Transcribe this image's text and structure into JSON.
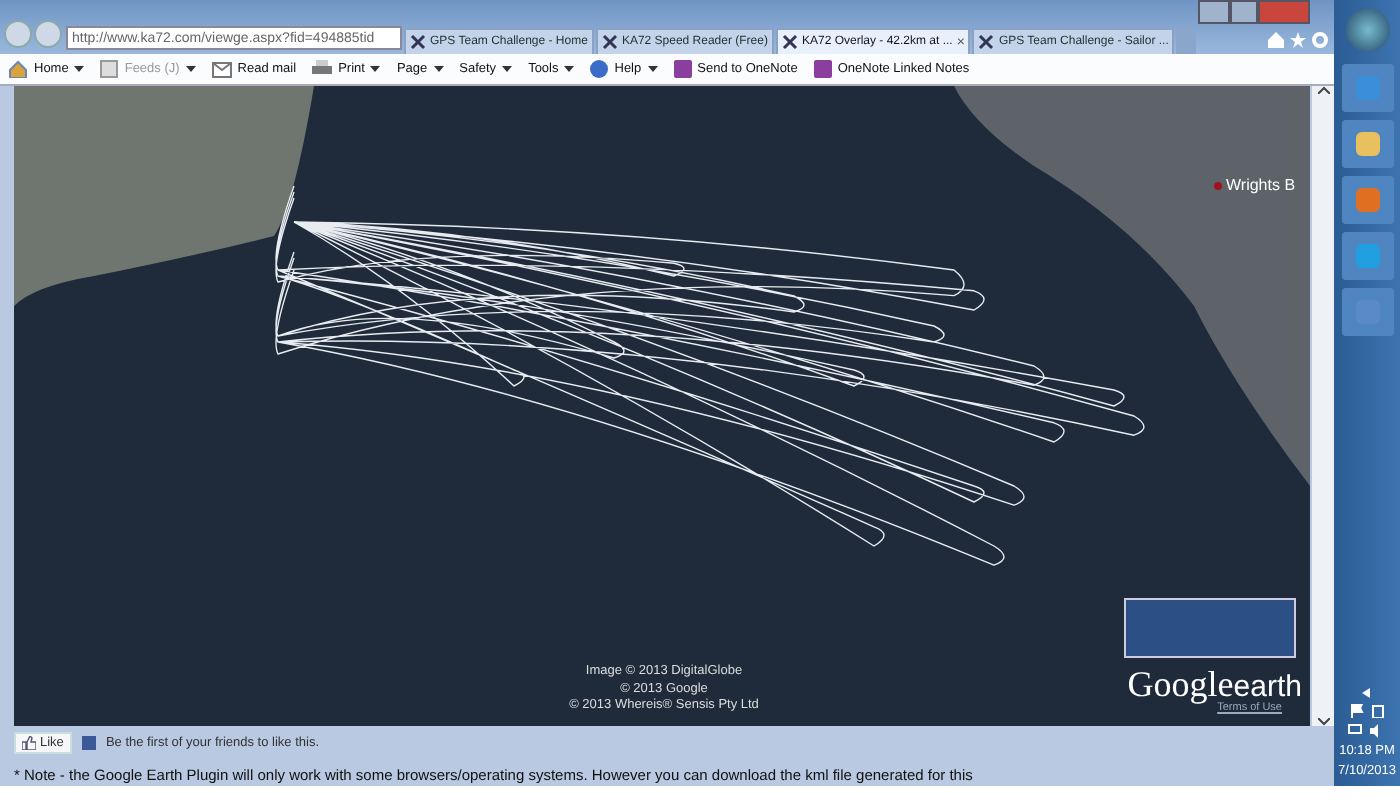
{
  "browser": {
    "address": "http://www.ka72.com/viewge.aspx?fid=494885tid",
    "tabs": [
      {
        "label": "GPS Team Challenge - Home",
        "selected": false
      },
      {
        "label": "KA72 Speed Reader (Free)",
        "selected": false
      },
      {
        "label": "KA72 Overlay - 42.2km at ...",
        "selected": true
      },
      {
        "label": "GPS Team Challenge - Sailor ...",
        "selected": false
      }
    ],
    "close_tab": "×",
    "command_bar": [
      {
        "label": "Home",
        "kind": "home",
        "dropdown": true,
        "disabled": false
      },
      {
        "label": "Feeds (J)",
        "kind": "feeds",
        "dropdown": true,
        "disabled": true
      },
      {
        "label": "Read mail",
        "kind": "mail",
        "dropdown": false,
        "disabled": false
      },
      {
        "label": "Print",
        "kind": "print",
        "dropdown": true,
        "disabled": false
      },
      {
        "label": "Page",
        "kind": "plain",
        "dropdown": true,
        "disabled": false
      },
      {
        "label": "Safety",
        "kind": "plain",
        "dropdown": true,
        "disabled": false
      },
      {
        "label": "Tools",
        "kind": "plain",
        "dropdown": true,
        "disabled": false
      },
      {
        "label": "Help",
        "kind": "help",
        "dropdown": true,
        "disabled": false
      },
      {
        "label": "Send to OneNote",
        "kind": "onenote",
        "dropdown": false,
        "disabled": false
      },
      {
        "label": "OneNote Linked Notes",
        "kind": "onenote",
        "dropdown": false,
        "disabled": false
      }
    ]
  },
  "map": {
    "place_label": "Wrights B",
    "attribution": [
      "Image © 2013 DigitalGlobe",
      "© 2013 Google",
      "© 2013 Whereis® Sensis Pty Ltd"
    ],
    "logo": {
      "word_1": "Google",
      "word_2": "earth"
    },
    "terms": "Terms of Use"
  },
  "social": {
    "like_button": "Like",
    "text": "Be the first of your friends to like this."
  },
  "note": "* Note - the Google Earth Plugin will only work with some browsers/operating systems. However you can download the kml file generated for this",
  "taskbar": {
    "time": "10:18 PM",
    "date": "7/10/2013"
  }
}
